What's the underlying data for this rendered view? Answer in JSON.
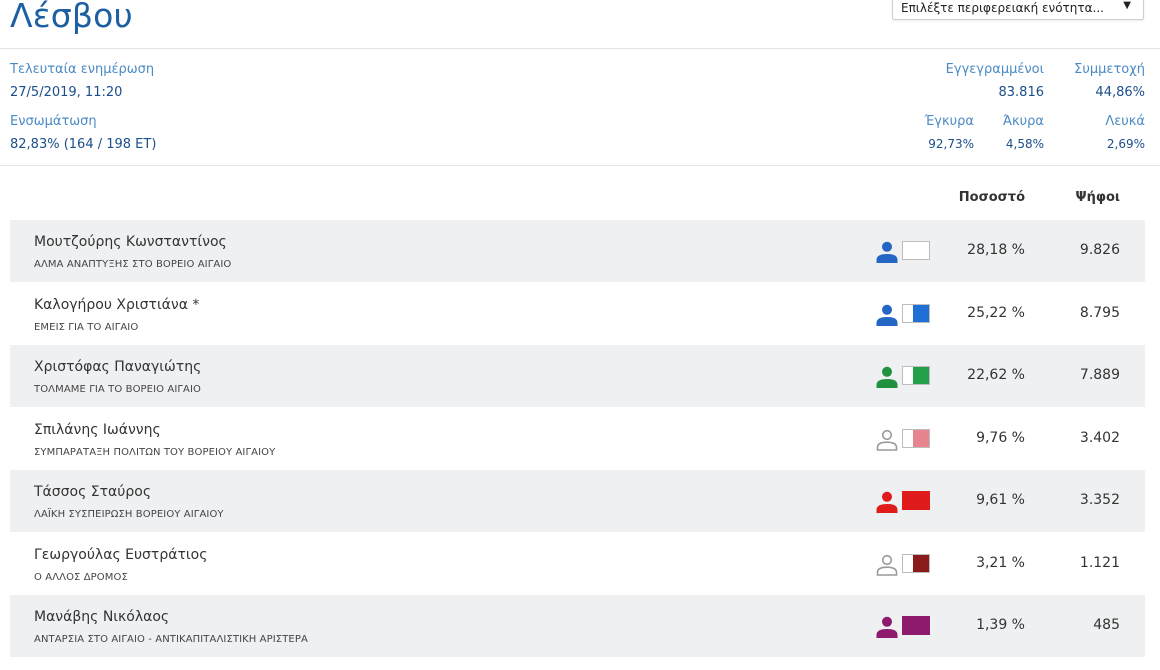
{
  "page": {
    "title": "Λέσβου"
  },
  "region_select": {
    "placeholder": "Επιλέξτε περιφερειακή ενότητα..."
  },
  "stats": {
    "last_update_label": "Τελευταία ενημέρωση",
    "last_update_value": "27/5/2019, 11:20",
    "integration_label": "Ενσωμάτωση",
    "integration_value": "82,83% (164 / 198 ΕΤ)",
    "registered_label": "Εγγεγραμμένοι",
    "registered_value": "83.816",
    "turnout_label": "Συμμετοχή",
    "turnout_value": "44,86%",
    "valid_label": "Έγκυρα",
    "valid_value": "92,73%",
    "invalid_label": "Άκυρα",
    "invalid_value": "4,58%",
    "blank_label": "Λευκά",
    "blank_value": "2,69%"
  },
  "table": {
    "col_percent": "Ποσοστό",
    "col_votes": "Ψήφοι",
    "rows": [
      {
        "name": "Μουτζούρης Κωνσταντίνος",
        "party": "ΑΛΜΑ ΑΝΑΠΤΥΞΗΣ ΣΤΟ ΒΟΡΕΙΟ ΑΙΓΑΙΟ",
        "percent": "28,18 %",
        "votes": "9.826",
        "person_color": "#2466c4",
        "party_color": ""
      },
      {
        "name": "Καλογήρου Χριστιάνα *",
        "party": "ΕΜΕΙΣ ΓΙΑ ΤΟ ΑΙΓΑΙΟ",
        "percent": "25,22 %",
        "votes": "8.795",
        "person_color": "#2466c4",
        "party_color": "#1f6fd6"
      },
      {
        "name": "Χριστόφας Παναγιώτης",
        "party": "ΤΟΛΜΑΜΕ ΓΙΑ ΤΟ ΒΟΡΕΙΟ ΑΙΓΑΙΟ",
        "percent": "22,62 %",
        "votes": "7.889",
        "person_color": "#22913f",
        "party_color": "#22a14a"
      },
      {
        "name": "Σπιλάνης Ιωάννης",
        "party": "ΣΥΜΠΑΡΑΤΑΞΗ ΠΟΛΙΤΩΝ ΤΟΥ ΒΟΡΕΙΟΥ ΑΙΓΑΙΟΥ",
        "percent": "9,76 %",
        "votes": "3.402",
        "person_color": "outline",
        "party_color": "#e8848f"
      },
      {
        "name": "Τάσσος Σταύρος",
        "party": "ΛΑΪΚΗ ΣΥΣΠΕΙΡΩΣΗ ΒΟΡΕΙΟΥ ΑΙΓΑΙΟΥ",
        "percent": "9,61 %",
        "votes": "3.352",
        "person_color": "#e01b1b",
        "party_color": "#e01b1b"
      },
      {
        "name": "Γεωργούλας Ευστράτιος",
        "party": "Ο ΑΛΛΟΣ ΔΡΟΜΟΣ",
        "percent": "3,21 %",
        "votes": "1.121",
        "person_color": "outline",
        "party_color": "#8b1a1a"
      },
      {
        "name": "Μανάβης Νικόλαος",
        "party": "ΑΝΤΑΡΣΙΑ ΣΤΟ ΑΙΓΑΙΟ - ΑΝΤΙΚΑΠΙΤΑΛΙΣΤΙΚΗ ΑΡΙΣΤΕΡΑ",
        "percent": "1,39 %",
        "votes": "485",
        "person_color": "#8e1a6e",
        "party_color": "#8e1a6e"
      }
    ]
  }
}
